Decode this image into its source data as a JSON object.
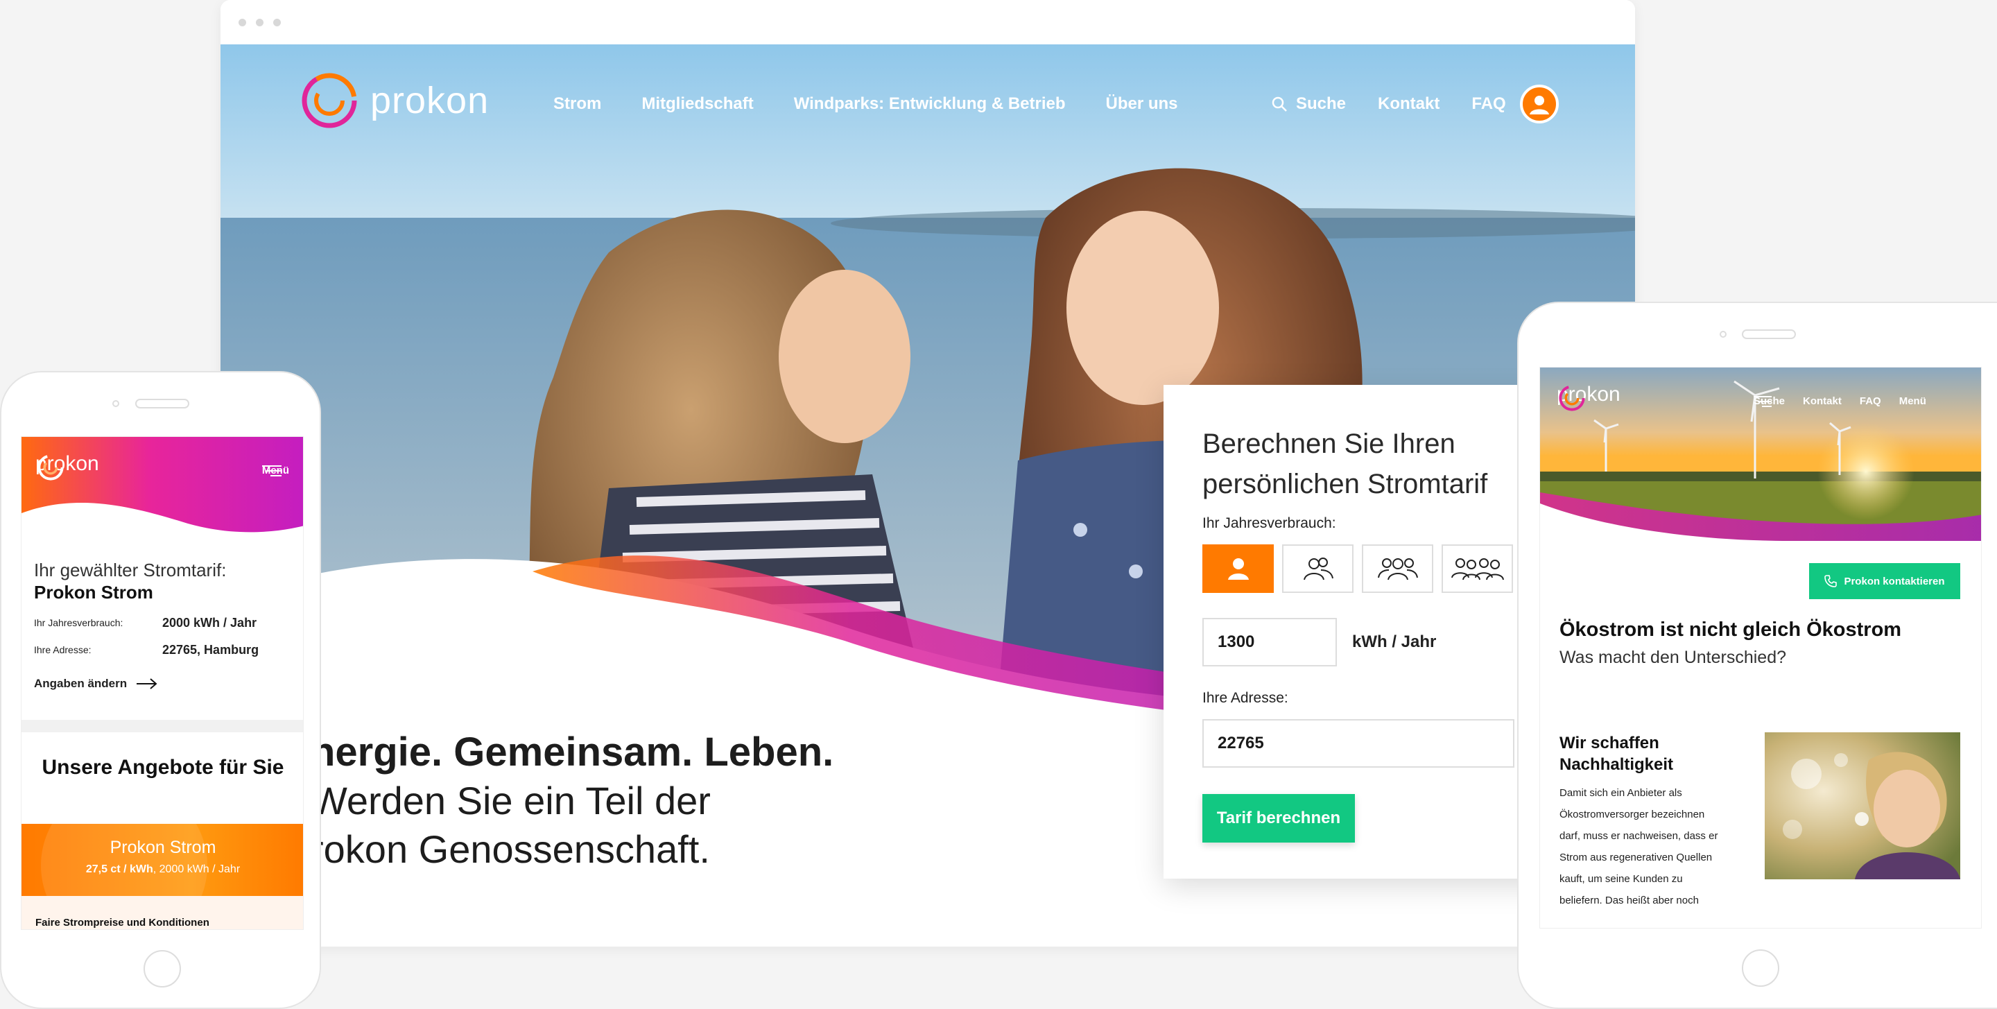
{
  "desktop": {
    "brand": "prokon",
    "nav": [
      "Strom",
      "Mitgliedschaft",
      "Windparks: Entwicklung & Betrieb",
      "Über uns"
    ],
    "search_label": "Suche",
    "contact_label": "Kontakt",
    "faq_label": "FAQ",
    "headline_bold": "nergie. Gemeinsam. Leben.",
    "headline_line2": "Werden Sie ein Teil der",
    "headline_line3": "rokon Genossenschaft."
  },
  "calculator": {
    "title_line1": "Berechnen Sie Ihren",
    "title_line2": "persönlichen Stromtarif",
    "consumption_label": "Ihr Jahresverbrauch:",
    "persons": [
      "1 person",
      "2 persons",
      "3 persons",
      "4 persons"
    ],
    "selected_person": 1,
    "consumption_value": "1300",
    "unit": "kWh / Jahr",
    "address_label": "Ihre Adresse:",
    "address_value": "22765",
    "submit_label": "Tarif berechnen"
  },
  "phone": {
    "brand": "prokon",
    "menu_label": "Menü",
    "tarif_heading": "Ihr gewählter Stromtarif:",
    "tarif_name": "Prokon Strom",
    "rows": [
      {
        "key": "Ihr Jahresverbrauch:",
        "value": "2000 kWh / Jahr"
      },
      {
        "key": "Ihre Adresse:",
        "value": "22765, Hamburg"
      }
    ],
    "change_label": "Angaben ändern",
    "offers_heading": "Unsere Angebote für Sie",
    "offer_title": "Prokon Strom",
    "offer_price": "27,5 ct / kWh",
    "offer_detail": ", 2000 kWh / Jahr",
    "fair_label": "Faire Strompreise und Konditionen"
  },
  "tablet": {
    "brand": "prokon",
    "nav": [
      "Suche",
      "Kontakt",
      "FAQ",
      "Menü"
    ],
    "contact_button": "Prokon kontaktieren",
    "heading": "Ökostrom ist nicht gleich Ökostrom",
    "subheading": "Was macht den Unterschied?",
    "section_title": "Wir schaffen Nachhaltigkeit",
    "body": "Damit sich ein Anbieter als Ökostromversorger bezeichnen darf, muss er nachweisen, dass er Strom aus regenerativen Quellen kauft, um seine Kunden zu beliefern. Das heißt aber noch"
  },
  "colors": {
    "orange": "#ff7a00",
    "magenta": "#d21aa0",
    "green": "#12c882"
  }
}
